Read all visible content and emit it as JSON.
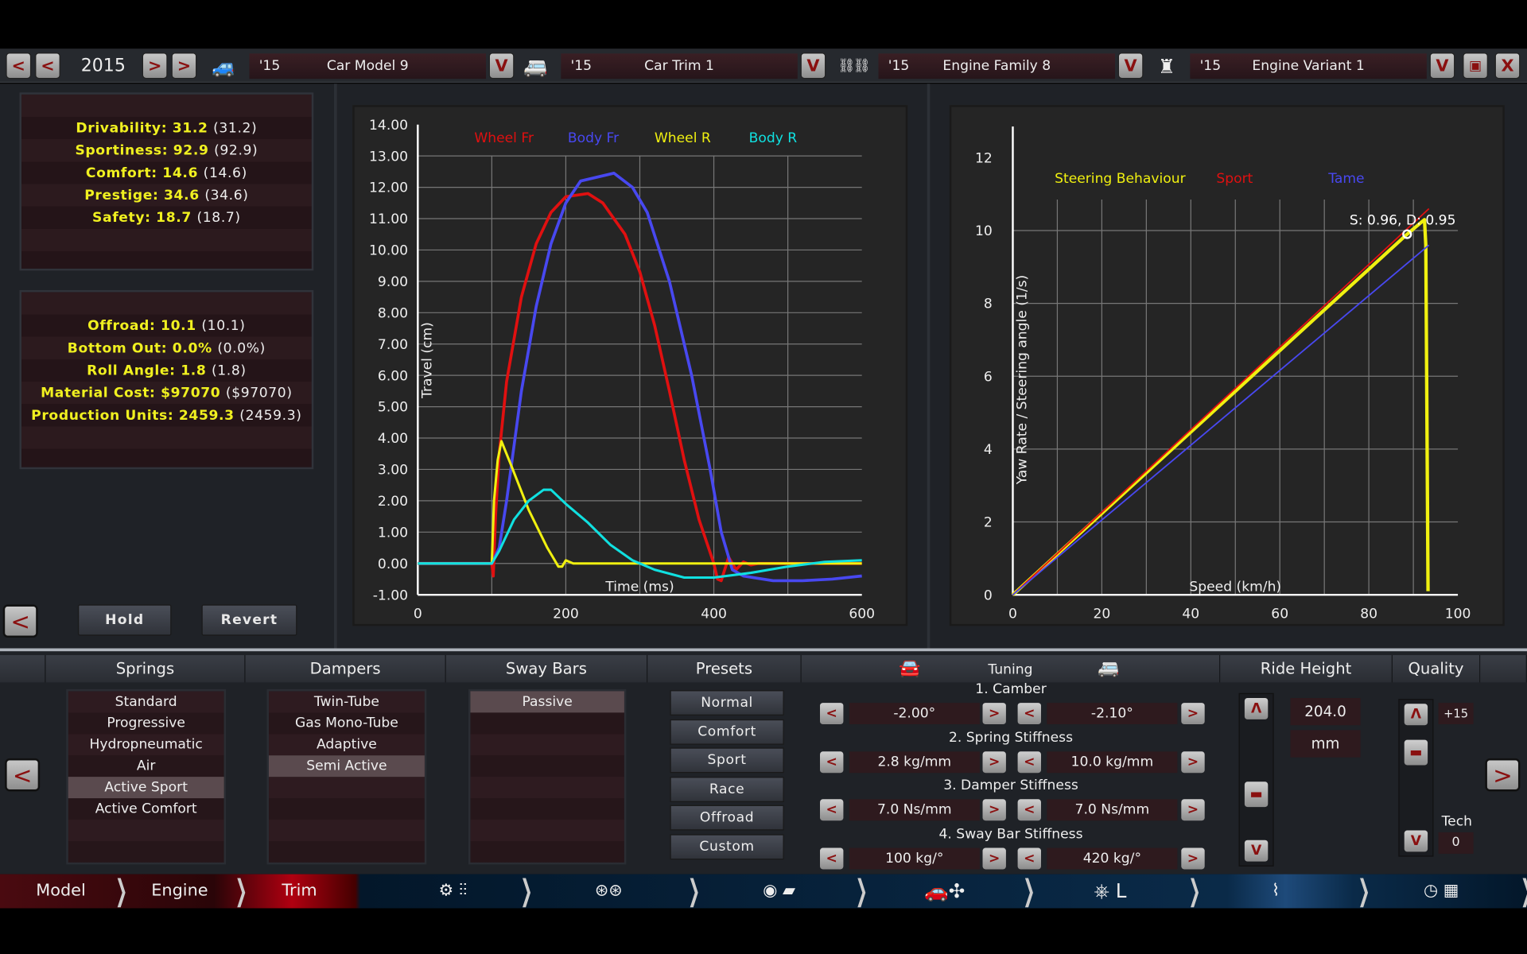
{
  "topbar": {
    "year": "2015",
    "model": {
      "year": "'15",
      "name": "Car Model 9"
    },
    "trim": {
      "year": "'15",
      "name": "Car Trim 1"
    },
    "engine_family": {
      "year": "'15",
      "name": "Engine Family 8"
    },
    "engine_variant": {
      "year": "'15",
      "name": "Engine Variant 1"
    },
    "prev": "<",
    "next": ">",
    "dropdown": "V",
    "close": "X"
  },
  "stats1": [
    {
      "label": "Drivability: 31.2",
      "prev": "(31.2)"
    },
    {
      "label": "Sportiness: 92.9",
      "prev": "(92.9)"
    },
    {
      "label": "Comfort: 14.6",
      "prev": "(14.6)"
    },
    {
      "label": "Prestige: 34.6",
      "prev": "(34.6)"
    },
    {
      "label": "Safety: 18.7",
      "prev": "(18.7)"
    }
  ],
  "stats2": [
    {
      "label": "Offroad: 10.1",
      "prev": "(10.1)"
    },
    {
      "label": "Bottom Out: 0.0%",
      "prev": "(0.0%)"
    },
    {
      "label": "Roll Angle: 1.8",
      "prev": "(1.8)"
    },
    {
      "label": "Material Cost: $97070",
      "prev": "($97070)"
    },
    {
      "label": "Production Units: 2459.3",
      "prev": "(2459.3)"
    }
  ],
  "buttons": {
    "back": "<",
    "hold": "Hold",
    "revert": "Revert",
    "forward": ">"
  },
  "chart_data": [
    {
      "type": "line",
      "xlabel": "Time (ms)",
      "ylabel": "Travel (cm)",
      "xlim": [
        0,
        600
      ],
      "ylim": [
        -1,
        14
      ],
      "xticks": [
        "0",
        "200",
        "400",
        "600"
      ],
      "yticks": [
        "14.00",
        "13.00",
        "12.00",
        "11.00",
        "10.00",
        "9.00",
        "8.00",
        "7.00",
        "6.00",
        "5.00",
        "4.00",
        "3.00",
        "2.00",
        "1.00",
        "0.00",
        "-1.00"
      ],
      "grid": true,
      "legend": "top",
      "series": [
        {
          "name": "Wheel Fr",
          "color": "#e01010",
          "points": [
            [
              0,
              0
            ],
            [
              100,
              0
            ],
            [
              102,
              -0.4
            ],
            [
              105,
              1.5
            ],
            [
              110,
              3.5
            ],
            [
              120,
              5.8
            ],
            [
              140,
              8.5
            ],
            [
              160,
              10.2
            ],
            [
              180,
              11.2
            ],
            [
              200,
              11.7
            ],
            [
              230,
              11.8
            ],
            [
              250,
              11.5
            ],
            [
              280,
              10.5
            ],
            [
              300,
              9.3
            ],
            [
              320,
              7.6
            ],
            [
              340,
              5.5
            ],
            [
              360,
              3.3
            ],
            [
              380,
              1.4
            ],
            [
              400,
              0
            ],
            [
              405,
              -0.5
            ],
            [
              410,
              -0.55
            ],
            [
              420,
              0.2
            ],
            [
              430,
              -0.2
            ],
            [
              440,
              0.05
            ],
            [
              450,
              -0.05
            ],
            [
              460,
              0
            ],
            [
              600,
              0
            ]
          ]
        },
        {
          "name": "Body Fr",
          "color": "#4848f0",
          "points": [
            [
              0,
              0
            ],
            [
              100,
              0
            ],
            [
              110,
              0.5
            ],
            [
              120,
              2
            ],
            [
              140,
              5.5
            ],
            [
              160,
              8.2
            ],
            [
              180,
              10.2
            ],
            [
              200,
              11.5
            ],
            [
              220,
              12.2
            ],
            [
              265,
              12.45
            ],
            [
              290,
              12
            ],
            [
              310,
              11.2
            ],
            [
              340,
              9
            ],
            [
              370,
              6
            ],
            [
              395,
              3
            ],
            [
              410,
              1
            ],
            [
              425,
              -0.2
            ],
            [
              440,
              -0.4
            ],
            [
              480,
              -0.55
            ],
            [
              520,
              -0.55
            ],
            [
              560,
              -0.5
            ],
            [
              600,
              -0.4
            ]
          ]
        },
        {
          "name": "Wheel R",
          "color": "#f0f010",
          "points": [
            [
              0,
              0
            ],
            [
              100,
              0
            ],
            [
              103,
              2
            ],
            [
              108,
              3.3
            ],
            [
              113,
              3.9
            ],
            [
              125,
              3.2
            ],
            [
              150,
              1.7
            ],
            [
              175,
              0.5
            ],
            [
              190,
              -0.1
            ],
            [
              195,
              -0.1
            ],
            [
              200,
              0.1
            ],
            [
              210,
              0
            ],
            [
              600,
              0
            ]
          ]
        },
        {
          "name": "Body R",
          "color": "#10e0e0",
          "points": [
            [
              0,
              0
            ],
            [
              100,
              0
            ],
            [
              110,
              0.4
            ],
            [
              130,
              1.4
            ],
            [
              150,
              2
            ],
            [
              170,
              2.35
            ],
            [
              180,
              2.35
            ],
            [
              200,
              1.9
            ],
            [
              230,
              1.3
            ],
            [
              260,
              0.6
            ],
            [
              290,
              0.1
            ],
            [
              320,
              -0.2
            ],
            [
              360,
              -0.45
            ],
            [
              400,
              -0.45
            ],
            [
              450,
              -0.3
            ],
            [
              500,
              -0.1
            ],
            [
              550,
              0.05
            ],
            [
              600,
              0.1
            ]
          ]
        }
      ]
    },
    {
      "type": "line",
      "xlabel": "Speed (km/h)",
      "ylabel": "Yaw Rate / Steering angle (1/s)",
      "xlim": [
        0,
        100
      ],
      "ylim": [
        0,
        12
      ],
      "xticks": [
        "0",
        "20",
        "40",
        "60",
        "80",
        "100"
      ],
      "yticks": [
        "12",
        "10",
        "8",
        "6",
        "4",
        "2",
        "0"
      ],
      "grid": true,
      "legend": "top",
      "series": [
        {
          "name": "Steering Behaviour",
          "color": "#f0f010",
          "points": [
            [
              0,
              0
            ],
            [
              88.6,
              9.9
            ],
            [
              92.5,
              10.3
            ],
            [
              92.8,
              9.6
            ],
            [
              93.3,
              0.1
            ]
          ]
        },
        {
          "name": "Sport",
          "color": "#e01010",
          "points": [
            [
              0,
              0
            ],
            [
              93.5,
              10.6
            ]
          ]
        },
        {
          "name": "Tame",
          "color": "#4848f0",
          "points": [
            [
              0,
              0
            ],
            [
              93.5,
              9.6
            ]
          ]
        }
      ],
      "annotation": {
        "text": "S: 0.96, D: 0.95",
        "x": 88.6,
        "y": 9.9
      }
    }
  ],
  "bottom": {
    "headers": {
      "springs": "Springs",
      "dampers": "Dampers",
      "sway": "Sway Bars",
      "presets": "Presets",
      "tuning": "Tuning",
      "ride": "Ride Height",
      "quality": "Quality"
    },
    "springs": [
      "Standard",
      "Progressive",
      "Hydropneumatic",
      "Air",
      "Active Sport",
      "Active Comfort"
    ],
    "springs_selected": 4,
    "dampers": [
      "Twin-Tube",
      "Gas Mono-Tube",
      "Adaptive",
      "Semi Active"
    ],
    "dampers_selected": 3,
    "sway": [
      "Passive"
    ],
    "sway_selected": 0,
    "presets": [
      "Normal",
      "Comfort",
      "Sport",
      "Race",
      "Offroad",
      "Custom"
    ],
    "tuning": [
      {
        "label": "1. Camber",
        "front": "-2.00°",
        "rear": "-2.10°"
      },
      {
        "label": "2. Spring Stiffness",
        "front": "2.8 kg/mm",
        "rear": "10.0 kg/mm"
      },
      {
        "label": "3. Damper Stiffness",
        "front": "7.0 Ns/mm",
        "rear": "7.0 Ns/mm"
      },
      {
        "label": "4. Sway Bar Stiffness",
        "front": "100 kg/°",
        "rear": "420 kg/°"
      }
    ],
    "ride_height": {
      "value": "204.0",
      "unit": "mm",
      "level": 0.35
    },
    "quality": {
      "value": "+15",
      "tech_label": "Tech",
      "tech": "0",
      "level": 0.85
    },
    "up": "Λ",
    "down": "V"
  },
  "nav": {
    "model": "Model",
    "engine": "Engine",
    "trim": "Trim"
  }
}
